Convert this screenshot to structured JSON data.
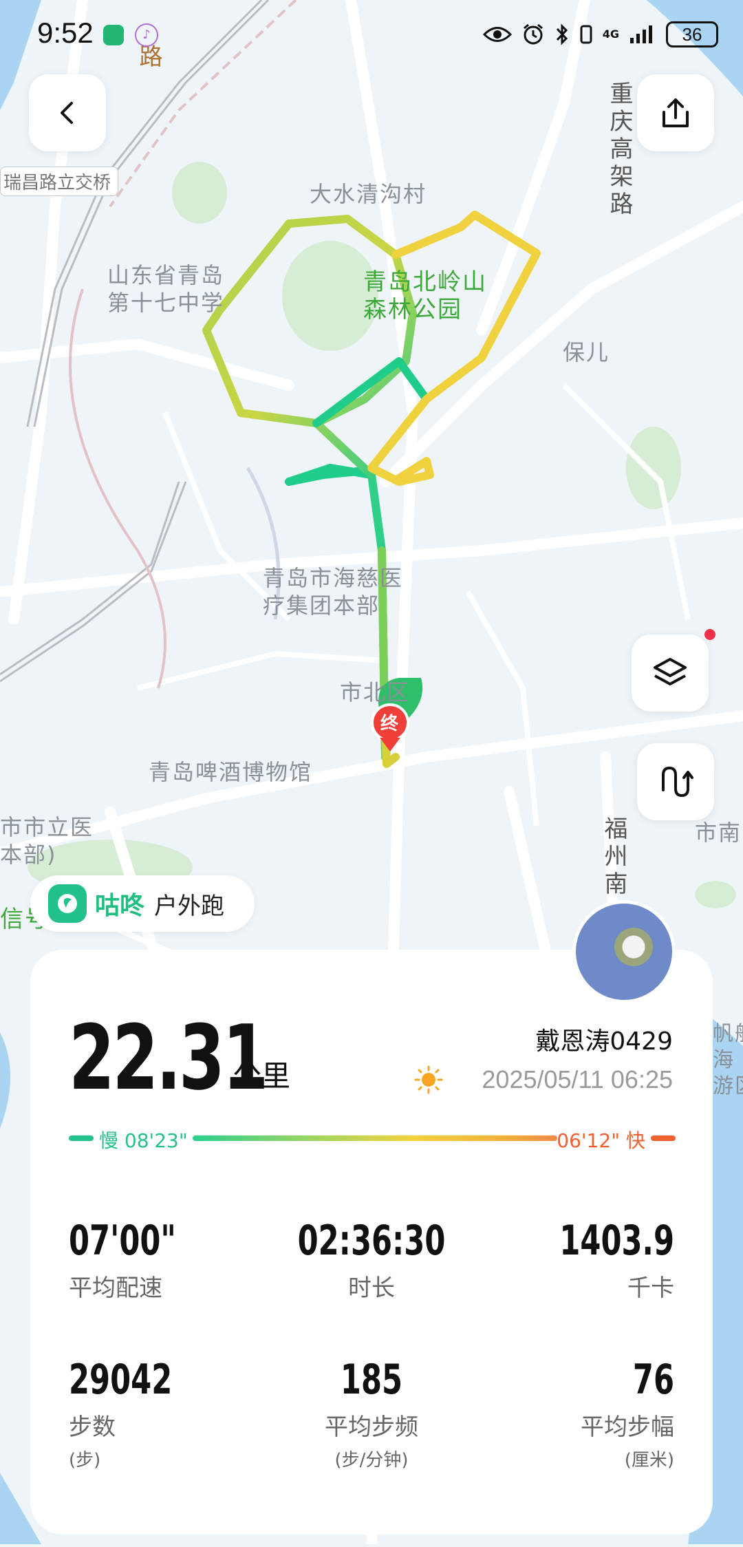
{
  "status_bar": {
    "time": "9:52",
    "battery": "36",
    "network": "4G",
    "icons": [
      "eye-icon",
      "alarm-icon",
      "bluetooth-icon",
      "vibrate-icon",
      "signal-icon",
      "battery-icon"
    ]
  },
  "map": {
    "road_chip": "瑞昌路立交桥",
    "labels": {
      "dashuiqinggou": "大水清沟村",
      "school": "山东省青岛\n第十七中学",
      "park": "青岛北岭山\n森林公园",
      "baoer": "保儿",
      "hospital": "青岛市海慈医\n疗集团本部",
      "district": "市北区",
      "museum": "青岛啤酒博物馆",
      "hospital2": "市市立医\n本部)",
      "shinan": "市南",
      "signal": "信号",
      "fanzhou": "帆船\n海\n游区"
    },
    "vertical_roads": {
      "chongqing": "重庆高架路",
      "fuzhou": "福州南",
      "road_top": "路"
    },
    "end_marker": "终"
  },
  "brand": {
    "name": "咕咚",
    "activity": "户外跑"
  },
  "summary": {
    "distance": "22.31",
    "distance_unit": "公里",
    "user": "戴恩涛0429",
    "datetime": "2025/05/11 06:25",
    "weather_icon": "sun-icon",
    "pace_slow_label": "慢 08'23\"",
    "pace_fast_label": "06'12\" 快",
    "colors": {
      "slow": "#26c189",
      "fast": "#f06030",
      "accent": "#1fbf80"
    }
  },
  "stats": [
    {
      "value": "07'00\"",
      "label": "平均配速",
      "sub": ""
    },
    {
      "value": "02:36:30",
      "label": "时长",
      "sub": ""
    },
    {
      "value": "1403.9",
      "label": "千卡",
      "sub": ""
    },
    {
      "value": "29042",
      "label": "步数",
      "sub": "(步)"
    },
    {
      "value": "185",
      "label": "平均步频",
      "sub": "(步/分钟)"
    },
    {
      "value": "76",
      "label": "平均步幅",
      "sub": "(厘米)"
    }
  ]
}
